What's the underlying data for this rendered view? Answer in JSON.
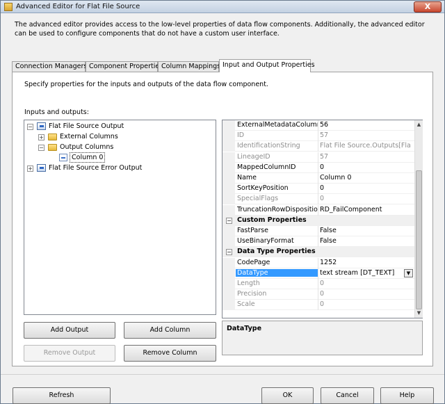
{
  "window": {
    "title": "Advanced Editor for Flat File Source",
    "close_glyph": "X"
  },
  "description": "The advanced editor provides access to the low-level properties of data flow components. Additionally, the advanced editor can be used to configure components that do not have a custom user interface.",
  "tabs": [
    {
      "label": "Connection Managers"
    },
    {
      "label": "Component Properties"
    },
    {
      "label": "Column Mappings"
    },
    {
      "label": "Input and Output Properties"
    }
  ],
  "panel": {
    "hint": "Specify properties for the inputs and outputs of the data flow component.",
    "io_label": "Inputs and outputs:"
  },
  "tree": {
    "source_output": "Flat File Source Output",
    "external_columns": "External Columns",
    "output_columns": "Output Columns",
    "column0": "Column 0",
    "error_output": "Flat File Source Error Output",
    "expanded_glyph": "−",
    "collapsed_glyph": "+"
  },
  "buttons": {
    "add_output": "Add Output",
    "add_column": "Add Column",
    "remove_output": "Remove Output",
    "remove_column": "Remove Column",
    "refresh": "Refresh",
    "ok": "OK",
    "cancel": "Cancel",
    "help": "Help"
  },
  "properties": {
    "rows": [
      {
        "name": "ExternalMetadataColumnID",
        "value": "56"
      },
      {
        "name": "ID",
        "value": "57",
        "readonly": true
      },
      {
        "name": "IdentificationString",
        "value": "Flat File Source.Outputs[Flat File",
        "readonly": true
      },
      {
        "name": "LineageID",
        "value": "57",
        "readonly": true
      },
      {
        "name": "MappedColumnID",
        "value": "0"
      },
      {
        "name": "Name",
        "value": "Column 0"
      },
      {
        "name": "SortKeyPosition",
        "value": "0"
      },
      {
        "name": "SpecialFlags",
        "value": "0",
        "readonly": true
      },
      {
        "name": "TruncationRowDisposition",
        "value": "RD_FailComponent"
      },
      {
        "category": "Custom Properties"
      },
      {
        "name": "FastParse",
        "value": "False"
      },
      {
        "name": "UseBinaryFormat",
        "value": "False"
      },
      {
        "category": "Data Type Properties"
      },
      {
        "name": "CodePage",
        "value": "1252"
      },
      {
        "name": "DataType",
        "value": "text stream [DT_TEXT]",
        "selected": true
      },
      {
        "name": "Length",
        "value": "0",
        "readonly": true
      },
      {
        "name": "Precision",
        "value": "0",
        "readonly": true
      },
      {
        "name": "Scale",
        "value": "0",
        "readonly": true
      }
    ],
    "category_glyph": "−",
    "dropdown_glyph": "▼",
    "scroll_up_glyph": "▲",
    "scroll_down_glyph": "▼"
  },
  "property_description": "DataType"
}
